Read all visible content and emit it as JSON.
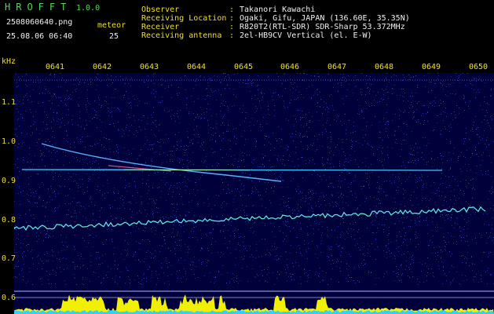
{
  "header": {
    "app_name": "HROFFT",
    "version": "1.0.0",
    "filename": "2508060640.png",
    "meteor_label": "meteor",
    "timestamp": "25.08.06 06:40",
    "meteor_count": "25",
    "info": [
      {
        "label": "Observer",
        "sep": ":",
        "value": "Takanori Kawachi"
      },
      {
        "label": "Receiving Location",
        "sep": ":",
        "value": "Ogaki, Gifu, JAPAN (136.60E, 35.35N)"
      },
      {
        "label": "Receiver",
        "sep": ":",
        "value": "R820T2(RTL-SDR) SDR-Sharp 53.372MHz"
      },
      {
        "label": "Receiving antenna",
        "sep": ":",
        "value": "2el-HB9CV Vertical (el. E-W)"
      }
    ]
  },
  "axis": {
    "y_unit": "kHz",
    "y_ticks": [
      "1.1",
      "1.0",
      "0.9",
      "0.8",
      "0.7",
      "0.6"
    ],
    "x_ticks": [
      "0641",
      "0642",
      "0643",
      "0644",
      "0645",
      "0646",
      "0647",
      "0648",
      "0649",
      "0650"
    ]
  },
  "colors": {
    "background": "#000000",
    "plot_background": "#00003a",
    "label_green": "#58d858",
    "label_yellow": "#f0e020",
    "text_white": "#f0f0f0",
    "trace_cyan": "#40e0ff"
  }
}
